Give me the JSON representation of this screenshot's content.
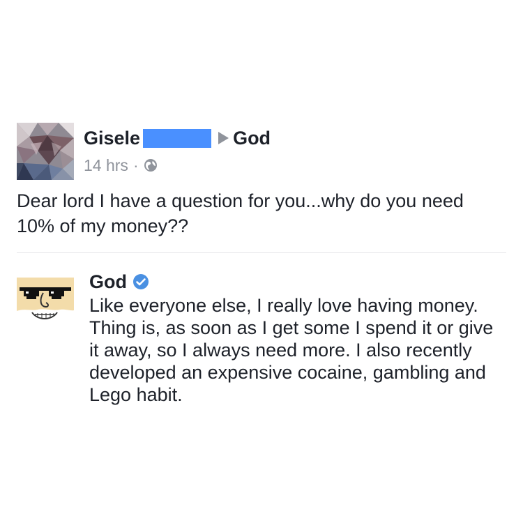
{
  "post": {
    "author": "Gisele",
    "target": "God",
    "time": "14 hrs",
    "separator": "·",
    "privacy_icon": "globe-icon",
    "text": "Dear lord I have a question for you...why do you need 10% of my money??",
    "redaction_color": "#4a90ff"
  },
  "comment": {
    "author": "God",
    "verified_icon": "verified-badge-icon",
    "text": "Like everyone else, I really love having money. Thing is, as soon as I get some I spend it or give it away, so I always need more. I also recently developed an expensive cocaine, gambling and Lego habit."
  },
  "colors": {
    "text": "#1d2129",
    "secondary": "#90949c",
    "verified": "#4a90e2",
    "divider": "#e5e6e9"
  }
}
